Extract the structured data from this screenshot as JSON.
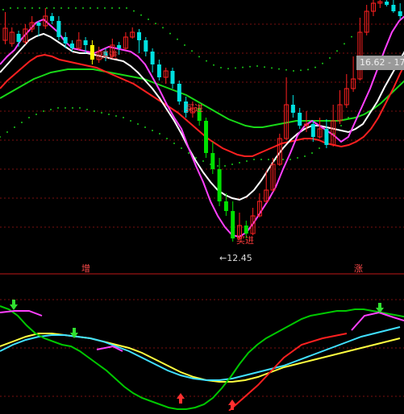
{
  "chart_data": {
    "type": "candlestick",
    "labels": {
      "buy_1": "买进",
      "buy_2": "买进",
      "buy_3": "买进",
      "low_price": "12.45",
      "price_box": "16.62 - 17"
    },
    "panel_markers": {
      "left": "增",
      "right": "涨"
    },
    "colors": {
      "up": "#ff2020",
      "down": "#00e0e0",
      "down_big": "#00e000",
      "white_ma": "#ffffff",
      "magenta_ma": "#ff40ff",
      "red_ma": "#ff2020",
      "green_ma": "#18d818",
      "dotted_band": "#18c818",
      "osc_main": "#00c800",
      "osc_yellow": "#ffff40",
      "osc_cyan": "#40e0ff"
    },
    "candles": [
      [
        50,
        35,
        55,
        15
      ],
      [
        54,
        40,
        58,
        34
      ],
      [
        42,
        52,
        58,
        38
      ],
      [
        52,
        36,
        55,
        30
      ],
      [
        36,
        28,
        40,
        20
      ],
      [
        28,
        32,
        45,
        26
      ],
      [
        32,
        20,
        36,
        10
      ],
      [
        20,
        26,
        30,
        16
      ],
      [
        26,
        46,
        50,
        20
      ],
      [
        46,
        54,
        60,
        40
      ],
      [
        54,
        60,
        64,
        50
      ],
      [
        60,
        50,
        62,
        40
      ],
      [
        50,
        56,
        66,
        46
      ],
      [
        56,
        74,
        80,
        50
      ],
      [
        74,
        64,
        78,
        58
      ],
      [
        64,
        70,
        76,
        60
      ],
      [
        70,
        56,
        72,
        48
      ],
      [
        56,
        60,
        68,
        52
      ],
      [
        60,
        46,
        62,
        40
      ],
      [
        46,
        40,
        48,
        34
      ],
      [
        40,
        50,
        66,
        36
      ],
      [
        50,
        64,
        70,
        46
      ],
      [
        64,
        80,
        90,
        60
      ],
      [
        80,
        96,
        100,
        74
      ],
      [
        96,
        88,
        104,
        84
      ],
      [
        88,
        104,
        110,
        84
      ],
      [
        104,
        126,
        130,
        100
      ],
      [
        126,
        140,
        146,
        120
      ],
      [
        140,
        134,
        146,
        126
      ],
      [
        134,
        150,
        156,
        130
      ],
      [
        150,
        190,
        196,
        146
      ],
      [
        190,
        210,
        216,
        176
      ],
      [
        210,
        250,
        256,
        196
      ],
      [
        250,
        262,
        268,
        240
      ],
      [
        262,
        296,
        300,
        250
      ],
      [
        296,
        280,
        298,
        264
      ],
      [
        280,
        290,
        296,
        274
      ],
      [
        290,
        268,
        292,
        258
      ],
      [
        268,
        250,
        270,
        240
      ],
      [
        250,
        236,
        252,
        212
      ],
      [
        236,
        204,
        238,
        196
      ],
      [
        204,
        172,
        206,
        166
      ],
      [
        172,
        130,
        174,
        96
      ],
      [
        130,
        140,
        146,
        118
      ],
      [
        140,
        156,
        160,
        134
      ],
      [
        156,
        154,
        164,
        138
      ],
      [
        154,
        170,
        176,
        150
      ],
      [
        170,
        160,
        172,
        146
      ],
      [
        160,
        180,
        184,
        148
      ],
      [
        180,
        150,
        182,
        130
      ],
      [
        150,
        130,
        154,
        112
      ],
      [
        130,
        110,
        134,
        92
      ],
      [
        110,
        98,
        114,
        70
      ],
      [
        98,
        40,
        100,
        22
      ],
      [
        40,
        14,
        44,
        6
      ],
      [
        14,
        4,
        20,
        0
      ],
      [
        4,
        2,
        10,
        0
      ],
      [
        2,
        6,
        8,
        0
      ],
      [
        6,
        14,
        16,
        0
      ],
      [
        14,
        20,
        24,
        4
      ]
    ],
    "ma_white": [
      90,
      80,
      70,
      60,
      50,
      45,
      42,
      46,
      52,
      58,
      64,
      66,
      66,
      68,
      70,
      72,
      74,
      76,
      82,
      90,
      100,
      110,
      122,
      136,
      150,
      166,
      184,
      200,
      214,
      226,
      236,
      242,
      246,
      248,
      244,
      236,
      224,
      210,
      196,
      184,
      174,
      166,
      160,
      156,
      156,
      158,
      160,
      162,
      164,
      160,
      154,
      140,
      126,
      108,
      92,
      76,
      60,
      46
    ],
    "ma_magenta": [
      80,
      70,
      62,
      48,
      38,
      28,
      24,
      32,
      40,
      52,
      60,
      62,
      64,
      66,
      62,
      58,
      60,
      62,
      64,
      70,
      80,
      96,
      112,
      130,
      146,
      160,
      184,
      206,
      226,
      250,
      268,
      282,
      292,
      294,
      288,
      276,
      262,
      248,
      232,
      210,
      190,
      168,
      156,
      150,
      156,
      162,
      168,
      176,
      170,
      150,
      130,
      110,
      86,
      62,
      40,
      26,
      18,
      14
    ],
    "ma_red": [
      110,
      100,
      92,
      84,
      76,
      70,
      68,
      70,
      74,
      76,
      78,
      80,
      82,
      84,
      88,
      92,
      96,
      100,
      104,
      110,
      116,
      122,
      128,
      134,
      140,
      148,
      156,
      164,
      172,
      178,
      184,
      188,
      192,
      194,
      194,
      190,
      186,
      182,
      178,
      176,
      174,
      172,
      172,
      174,
      178,
      180,
      182,
      180,
      176,
      170,
      160,
      146,
      128,
      110,
      90,
      72
    ],
    "ma_green": [
      122,
      116,
      110,
      104,
      98,
      94,
      90,
      88,
      86,
      86,
      86,
      86,
      88,
      90,
      92,
      94,
      96,
      98,
      102,
      106,
      110,
      114,
      118,
      124,
      130,
      136,
      142,
      148,
      152,
      156,
      158,
      158,
      156,
      154,
      152,
      150,
      150,
      150,
      150,
      150,
      150,
      148,
      146,
      142,
      136,
      128,
      118,
      108,
      98
    ],
    "osc_main": [
      380,
      384,
      392,
      404,
      414,
      420,
      424,
      428,
      430,
      436,
      444,
      452,
      460,
      470,
      480,
      488,
      494,
      498,
      502,
      506,
      508,
      508,
      506,
      502,
      494,
      482,
      468,
      452,
      438,
      428,
      420,
      414,
      408,
      402,
      396,
      392,
      390,
      388,
      386,
      386,
      384,
      384,
      386,
      388,
      390,
      392,
      394
    ],
    "osc_yellow": [
      430,
      424,
      418,
      414,
      414,
      416,
      418,
      420,
      424,
      428,
      432,
      438,
      446,
      454,
      462,
      468,
      472,
      474,
      474,
      472,
      468,
      462,
      456,
      452,
      448,
      444,
      440,
      436,
      432,
      428,
      424,
      420
    ],
    "osc_cyan": [
      436,
      428,
      422,
      418,
      416,
      416,
      418,
      420,
      424,
      430,
      436,
      444,
      452,
      460,
      466,
      470,
      472,
      472,
      470,
      466,
      462,
      458,
      454,
      448,
      442,
      436,
      430,
      424,
      418,
      414,
      410,
      406
    ]
  }
}
